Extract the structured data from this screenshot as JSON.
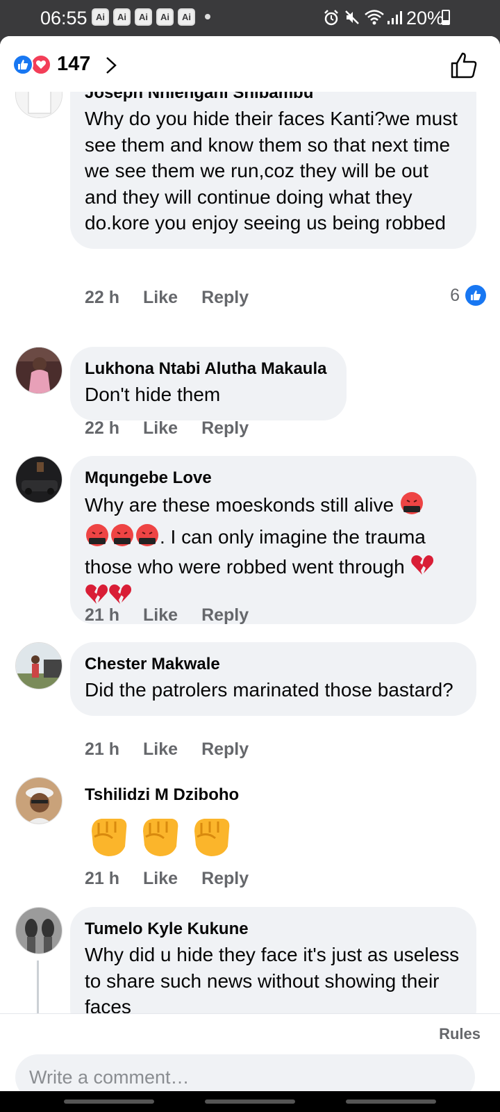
{
  "status_bar": {
    "time": "06:55",
    "ai_badges": [
      "Ai",
      "Ai",
      "Ai",
      "Ai",
      "Ai"
    ],
    "battery": "20%",
    "icons": [
      "alarm-icon",
      "mute-icon",
      "wifi-icon",
      "signal-icon",
      "battery-icon"
    ]
  },
  "header": {
    "reaction_count": "147",
    "reaction_types": [
      "like",
      "love"
    ]
  },
  "comments": [
    {
      "author": "Joseph Nhlengani Shibambu",
      "text": "Why do you hide their faces Kanti?we must see them and know them so that next time we see them we run,coz they will be out and they will continue doing what they do.kore you enjoy seeing us being robbed",
      "time": "22 h",
      "like_label": "Like",
      "reply_label": "Reply",
      "reactions": "6"
    },
    {
      "author": "Lukhona Ntabi Alutha Makaula",
      "text": "Don't hide them",
      "time": "22 h",
      "like_label": "Like",
      "reply_label": "Reply"
    },
    {
      "author": "Mqungebe Love",
      "text_parts": [
        "Why are these moeskonds still alive ",
        ". I can only imagine the trauma those who were robbed went through "
      ],
      "time": "21 h",
      "like_label": "Like",
      "reply_label": "Reply"
    },
    {
      "author": "Chester Makwale",
      "text": "Did the patrolers marinated those bastard?",
      "time": "21 h",
      "like_label": "Like",
      "reply_label": "Reply"
    },
    {
      "author": "Tshilidzi M Dziboho",
      "time": "21 h",
      "like_label": "Like",
      "reply_label": "Reply"
    },
    {
      "author": "Tumelo Kyle Kukune",
      "text": "Why did u hide they face it's just as useless to share such news without showing their faces"
    }
  ],
  "footer": {
    "rules": "Rules",
    "placeholder": "Write a comment…"
  },
  "colors": {
    "accent": "#1877f2",
    "love": "#f33e58",
    "bubble": "#f0f2f5",
    "meta": "#65676b"
  }
}
